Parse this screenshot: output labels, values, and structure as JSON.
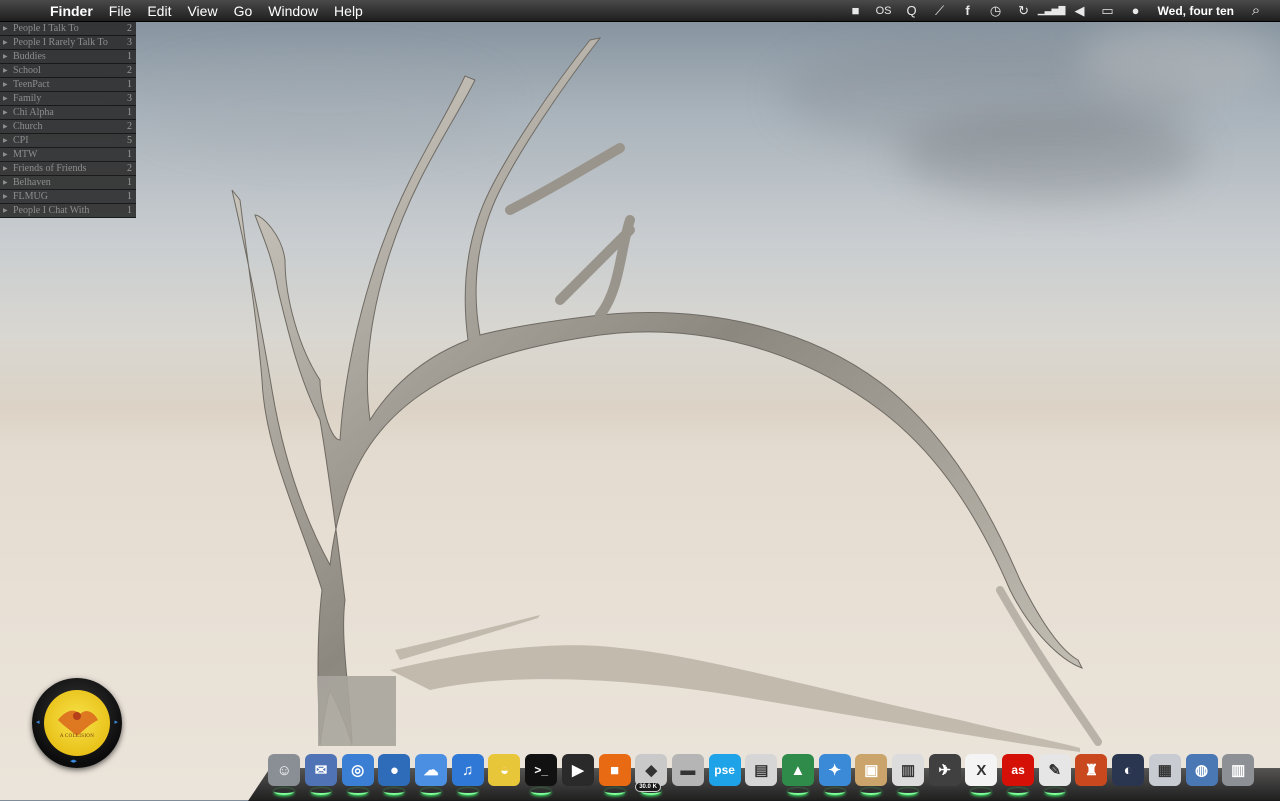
{
  "menubar": {
    "apple_glyph": "",
    "app_name": "Finder",
    "menus": [
      "File",
      "Edit",
      "View",
      "Go",
      "Window",
      "Help"
    ],
    "status_items": [
      {
        "name": "stop-icon",
        "glyph": "■"
      },
      {
        "name": "os-icon",
        "glyph": "OS"
      },
      {
        "name": "quicksilver-icon",
        "glyph": "Q"
      },
      {
        "name": "growl-icon",
        "glyph": "⟋"
      },
      {
        "name": "facebook-icon",
        "glyph": "f"
      },
      {
        "name": "time-machine-icon",
        "glyph": "◷"
      },
      {
        "name": "sync-icon",
        "glyph": "↻"
      },
      {
        "name": "wifi-signal-icon",
        "glyph": "▁▃▅▇"
      },
      {
        "name": "volume-icon",
        "glyph": "◀"
      },
      {
        "name": "battery-icon",
        "glyph": "▭"
      },
      {
        "name": "user-icon",
        "glyph": "●"
      }
    ],
    "clock": "Wed, four ten",
    "spotlight_glyph": "⌕"
  },
  "buddy_list": {
    "groups": [
      {
        "name": "People I Talk To",
        "count": "2"
      },
      {
        "name": "People I Rarely Talk To",
        "count": "3"
      },
      {
        "name": "Buddies",
        "count": "1"
      },
      {
        "name": "School",
        "count": "2"
      },
      {
        "name": "TeenPact",
        "count": "1"
      },
      {
        "name": "Family",
        "count": "3"
      },
      {
        "name": "Chi Alpha",
        "count": "1"
      },
      {
        "name": "Church",
        "count": "2"
      },
      {
        "name": "CPI",
        "count": "5"
      },
      {
        "name": "MTW",
        "count": "1"
      },
      {
        "name": "Friends of Friends",
        "count": "2"
      },
      {
        "name": "Belhaven",
        "count": "1"
      },
      {
        "name": "FLMUG",
        "count": "1"
      },
      {
        "name": "People I Chat With",
        "count": "1"
      }
    ]
  },
  "widget": {
    "album_label": "A COLLISION",
    "prev_glyph": "◂",
    "next_glyph": "▸",
    "play_glyph": "◂▸"
  },
  "dock": {
    "items": [
      {
        "name": "finder-icon",
        "glyph": "☺",
        "bg": "#8a8f96",
        "running": true
      },
      {
        "name": "mail-icon",
        "glyph": "✉",
        "bg": "#4f73b5",
        "running": true
      },
      {
        "name": "safari-icon",
        "glyph": "◎",
        "bg": "#3b7fd4",
        "running": true
      },
      {
        "name": "twitterrific-icon",
        "glyph": "●",
        "bg": "#2e6bb8",
        "running": true
      },
      {
        "name": "ichat-icon",
        "glyph": "☁",
        "bg": "#4a8fe2",
        "running": true
      },
      {
        "name": "itunes-icon",
        "glyph": "♫",
        "bg": "#2f78d6",
        "running": true
      },
      {
        "name": "cyberduck-icon",
        "glyph": "◒",
        "bg": "#e8c63a",
        "running": false
      },
      {
        "name": "terminal-icon",
        "glyph": ">_",
        "bg": "#111111",
        "running": true
      },
      {
        "name": "dvd-player-icon",
        "glyph": "▶",
        "bg": "#2a2a2a",
        "running": false
      },
      {
        "name": "orange-app-icon",
        "glyph": "■",
        "bg": "#e86a12",
        "running": true
      },
      {
        "name": "transmission-icon",
        "glyph": "◆",
        "bg": "#c9c9c9",
        "running": true,
        "badge": "30.0 K"
      },
      {
        "name": "scanner-icon",
        "glyph": "▬",
        "bg": "#b5b5b5",
        "running": false
      },
      {
        "name": "photoshop-elements-icon",
        "glyph": "pse",
        "bg": "#1fa3e8",
        "running": false
      },
      {
        "name": "preview-icon",
        "glyph": "▤",
        "bg": "#d6d6d6",
        "running": false
      },
      {
        "name": "omnifocus-icon",
        "glyph": "▲",
        "bg": "#2e8b4a",
        "running": true
      },
      {
        "name": "tweetdeck-icon",
        "glyph": "✦",
        "bg": "#3a8ad8",
        "running": true
      },
      {
        "name": "iphoto-icon",
        "glyph": "▣",
        "bg": "#caa46a",
        "running": true
      },
      {
        "name": "image-capture-icon",
        "glyph": "▥",
        "bg": "#dcdcdc",
        "running": true
      },
      {
        "name": "nova-icon",
        "glyph": "✈",
        "bg": "#404040",
        "running": false
      },
      {
        "name": "x11-icon",
        "glyph": "X",
        "bg": "#f4f4f4",
        "running": true
      },
      {
        "name": "lastfm-icon",
        "glyph": "as",
        "bg": "#d51007",
        "running": true
      },
      {
        "name": "textedit-icon",
        "glyph": "✎",
        "bg": "#e6e6e6",
        "running": true
      },
      {
        "name": "mario-icon",
        "glyph": "♜",
        "bg": "#c9481e",
        "running": false
      },
      {
        "name": "dashboard-icon",
        "glyph": "◐",
        "bg": "#2a3550",
        "running": false
      },
      {
        "name": "downloads-folder-icon",
        "glyph": "▦",
        "bg": "#c8ccd2",
        "running": false
      },
      {
        "name": "network-icon",
        "glyph": "◍",
        "bg": "#4a78b5",
        "running": false
      },
      {
        "name": "trash-icon",
        "glyph": "▥",
        "bg": "#8d9095",
        "running": false
      }
    ]
  }
}
